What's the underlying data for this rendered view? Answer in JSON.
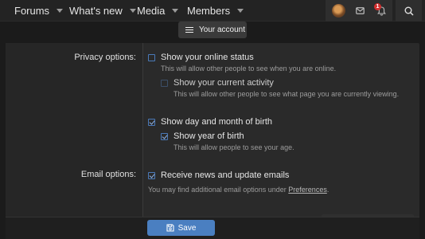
{
  "nav": {
    "items": [
      {
        "label": "Forums"
      },
      {
        "label": "What's new"
      },
      {
        "label": "Media"
      },
      {
        "label": "Members"
      }
    ],
    "notification_count": "1",
    "icons": {
      "avatar": "user-avatar",
      "mail": "envelope-icon",
      "bell": "bell-icon",
      "search": "search-icon"
    }
  },
  "account_button": {
    "label": "Your account",
    "icon": "hamburger-icon"
  },
  "privacy": {
    "label": "Privacy options:",
    "options": [
      {
        "label": "Show your online status",
        "checked": false,
        "hint": "This will allow other people to see when you are online."
      },
      {
        "label": "Show your current activity",
        "checked": false,
        "disabled": true,
        "hint": "This will allow other people to see what page you are currently viewing."
      },
      {
        "label": "Show day and month of birth",
        "checked": true
      },
      {
        "label": "Show year of birth",
        "checked": true,
        "hint": "This will allow people to see your age."
      }
    ]
  },
  "email": {
    "label": "Email options:",
    "option": {
      "label": "Receive news and update emails",
      "checked": true
    },
    "hint_prefix": "You may find additional email options under ",
    "hint_link": "Preferences",
    "hint_suffix": "."
  },
  "footer": {
    "save_label": "Save",
    "save_icon": "save-icon"
  },
  "colors": {
    "background": "#1b1b1b",
    "panel": "#2a2a2a",
    "accent": "#4a7fc1",
    "badge": "#d32f2f"
  }
}
